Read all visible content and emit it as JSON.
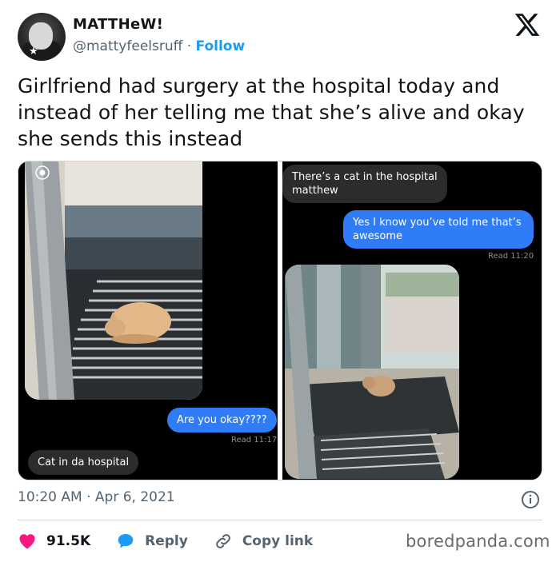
{
  "author": {
    "display_name": "MATTHeW!",
    "handle": "@mattyfeelsruff",
    "separator": "·",
    "follow_label": "Follow"
  },
  "tweet": {
    "text": "Girlfriend had surgery at the hospital today and instead of her telling me that she’s alive and okay she sends this instead",
    "timestamp": "10:20 AM · Apr 6, 2021"
  },
  "media": {
    "left": {
      "bubble_sent": "Are you okay????",
      "read_receipt": "Read 11:17",
      "bubble_received": "Cat in da hospital"
    },
    "right": {
      "bubble_received": "There’s a cat in the hospital matthew",
      "bubble_sent": "Yes I know you’ve told me that’s awesome",
      "read_receipt": "Read 11:20"
    }
  },
  "actions": {
    "like_count": "91.5K",
    "reply_label": "Reply",
    "copy_label": "Copy link"
  },
  "watermark": "boredpanda.com",
  "colors": {
    "accent": "#1d9bf0",
    "like": "#f91880",
    "reply": "#1d9bf0",
    "imessage_blue": "#2f7cf6",
    "imessage_gray": "#2c2c2e"
  },
  "icons": {
    "logo": "x-logo-icon",
    "info": "info-icon",
    "like": "heart-icon",
    "reply": "reply-bubble-icon",
    "copy": "link-icon"
  }
}
